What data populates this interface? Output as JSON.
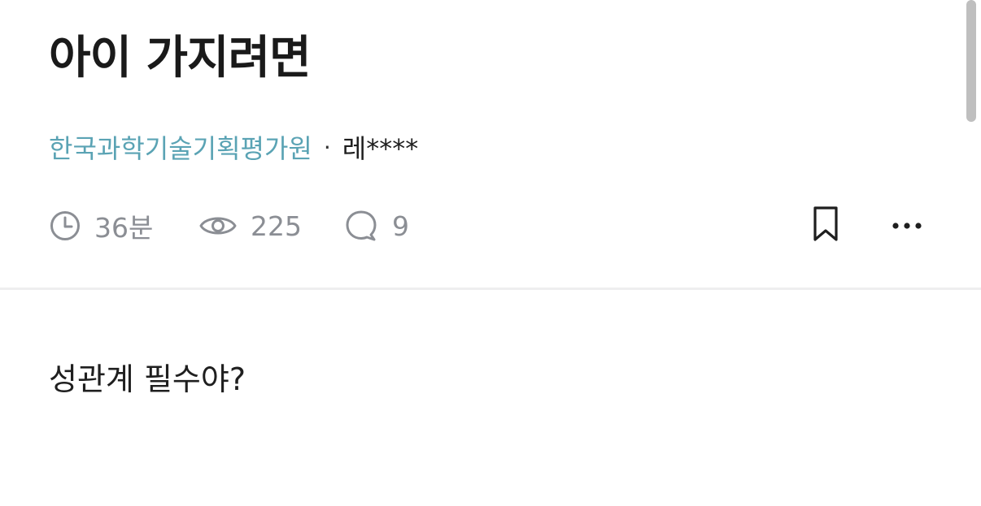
{
  "post": {
    "title": "아이 가지려면",
    "company": "한국과학기술기획평가원",
    "separator": "·",
    "author": "레****",
    "body": "성관계 필수야?"
  },
  "stats": {
    "time": "36분",
    "views": "225",
    "comments": "9"
  },
  "icons": {
    "time": "clock-icon",
    "views": "eye-icon",
    "comments": "comment-bubble-icon",
    "bookmark": "bookmark-icon",
    "more": "more-dots-icon"
  },
  "colors": {
    "company_link": "#5aa3b4",
    "meta_gray": "#8b8e94",
    "text": "#1a1a1a"
  }
}
